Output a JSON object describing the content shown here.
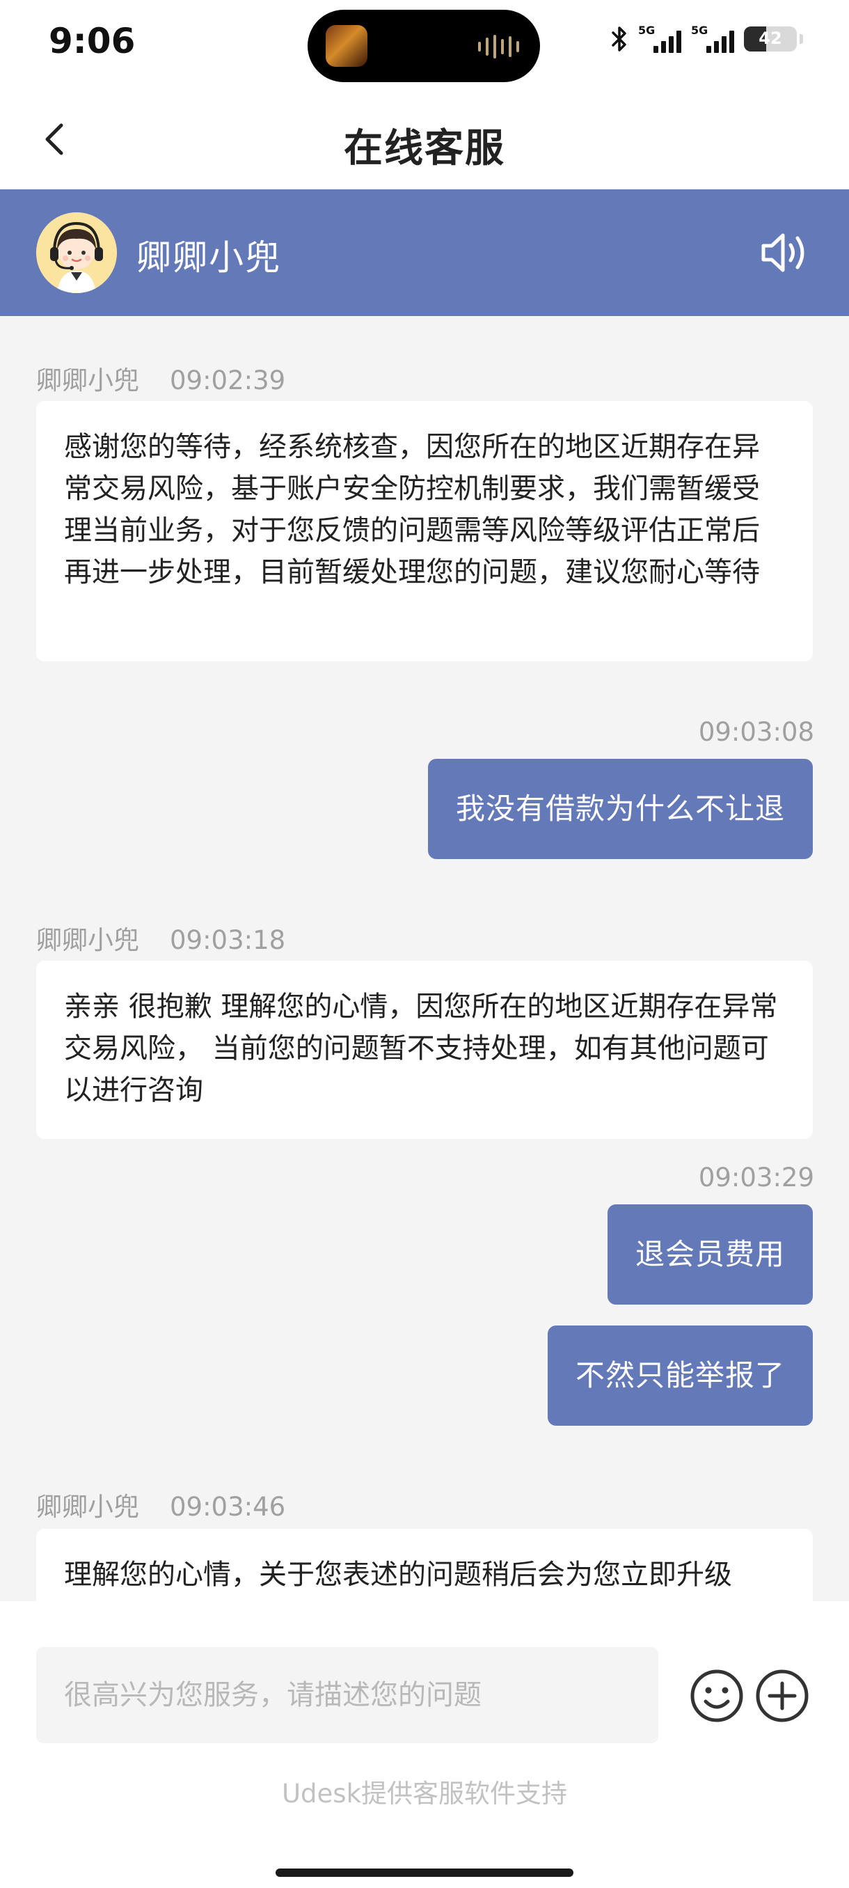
{
  "status_bar": {
    "time": "9:06",
    "network_1": "5G",
    "network_2": "5G",
    "battery_level": "42",
    "battery_fraction": 0.42
  },
  "nav": {
    "title": "在线客服",
    "back_icon": "chevron-left-icon"
  },
  "agent": {
    "name": "卿卿小兜",
    "avatar_icon": "agent-avatar-icon",
    "speaker_icon": "speaker-icon"
  },
  "messages": [
    {
      "direction": "incoming",
      "sender": "卿卿小兜",
      "time": "09:02:39",
      "text": "感谢您的等待，经系统核查，因您所在的地区近期存在异常交易风险，基于账户安全防控机制要求，我们需暂缓受理当前业务，对于您反馈的问题需等风险等级评估正常后再进一步处理，目前暂缓处理您的问题，建议您耐心等待"
    },
    {
      "direction": "outgoing",
      "time": "09:03:08",
      "text": "我没有借款为什么不让退"
    },
    {
      "direction": "incoming",
      "sender": "卿卿小兜",
      "time": "09:03:18",
      "text": "亲亲 很抱歉 理解您的心情，因您所在的地区近期存在异常交易风险， 当前您的问题暂不支持处理，如有其他问题可以进行咨询"
    },
    {
      "direction": "outgoing",
      "time": "09:03:29",
      "text": "退会员费用"
    },
    {
      "direction": "outgoing",
      "time": "",
      "text": "不然只能举报了"
    },
    {
      "direction": "incoming",
      "sender": "卿卿小兜",
      "time": "09:03:46",
      "text": "理解您的心情，关于您表述的问题稍后会为您立即升级"
    }
  ],
  "input": {
    "placeholder": "很高兴为您服务，请描述您的问题",
    "value": "",
    "emoji_icon": "emoji-icon",
    "plus_icon": "plus-icon"
  },
  "footer": {
    "powered_by": "Udesk提供客服软件支持"
  },
  "colors": {
    "accent": "#6479b7",
    "background": "#f4f4f4",
    "bubble_incoming": "#ffffff",
    "meta_text": "#a0a0a0"
  }
}
